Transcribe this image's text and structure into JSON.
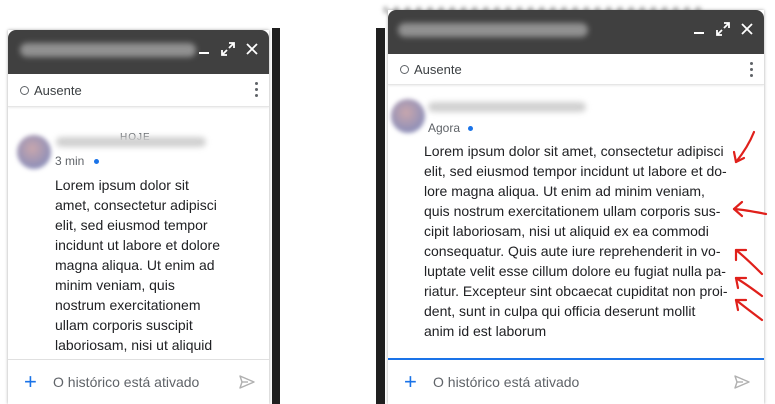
{
  "left_window": {
    "status": "Ausente",
    "day_separator": "HOJE",
    "message": {
      "time": "3 min",
      "text": "Lorem ipsum dolor sit\namet, consectetur adipisci\nelit, sed eiusmod tempor\nincidunt ut labore et dolore\nmagna aliqua. Ut enim ad\nminim veniam, quis\nnostrum exercitationem\nullam corporis suscipit\nlaboriosam, nisi ut aliquid"
    },
    "composer_placeholder": "O histórico está ativado"
  },
  "right_window": {
    "status": "Ausente",
    "message": {
      "time": "Agora",
      "text": "Lorem ipsum dolor sit amet, consectetur adipisci\nelit, sed eiusmod tempor incidunt ut labore et do-\nlore magna aliqua. Ut enim ad minim veniam,\nquis nostrum exercitationem ullam corporis sus-\ncipit laboriosam, nisi ut aliquid ex ea commodi\nconsequatur. Quis aute iure reprehenderit in vo-\nluptate velit esse cillum dolore eu fugiat nulla pa-\nriatur. Excepteur sint obcaecat cupiditat non proi-\ndent, sunt in culpa qui officia deserunt mollit\nanim id est laborum"
    },
    "composer_placeholder": "O histórico está ativado"
  },
  "icons": {
    "minimize": "minimize-icon",
    "popout": "popout-icon",
    "close": "close-icon",
    "more": "more-vert-icon",
    "add": "add-icon",
    "send": "send-icon"
  },
  "colors": {
    "titlebar": "#404040",
    "accent_blue": "#1a73e8",
    "annotation_red": "#e0201b"
  }
}
